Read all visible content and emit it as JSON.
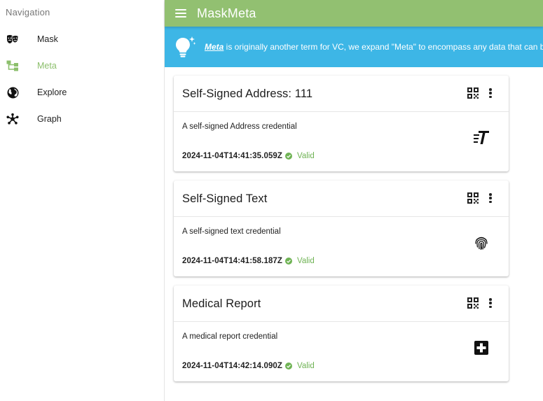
{
  "app": {
    "title": "MaskMeta"
  },
  "sidebar": {
    "heading": "Navigation",
    "items": [
      {
        "label": "Mask",
        "icon": "theater-masks-icon",
        "active": false
      },
      {
        "label": "Meta",
        "icon": "hierarchy-icon",
        "active": true
      },
      {
        "label": "Explore",
        "icon": "globe-icon",
        "active": false
      },
      {
        "label": "Graph",
        "icon": "network-graph-icon",
        "active": false
      }
    ]
  },
  "banner": {
    "keyword": "Meta",
    "text": " is originally another term for VC, we expand \"Meta\" to encompass any data that can be en",
    "icon": "lightbulb-icon"
  },
  "cards": [
    {
      "title": "Self-Signed Address: 111",
      "description": "A self-signed Address credential",
      "timestamp": "2024-11-04T14:41:35.059Z",
      "status": "Valid",
      "icon": "text-format-icon"
    },
    {
      "title": "Self-Signed Text",
      "description": "A self-signed text credential",
      "timestamp": "2024-11-04T14:41:58.187Z",
      "status": "Valid",
      "icon": "fingerprint-icon"
    },
    {
      "title": "Medical Report",
      "description": "A medical report credential",
      "timestamp": "2024-11-04T14:42:14.090Z",
      "status": "Valid",
      "icon": "medical-cross-icon"
    }
  ],
  "colors": {
    "topbar": "#92c071",
    "banner": "#3db6e6",
    "active_nav": "#8cbf6c",
    "valid": "#6fb354"
  }
}
